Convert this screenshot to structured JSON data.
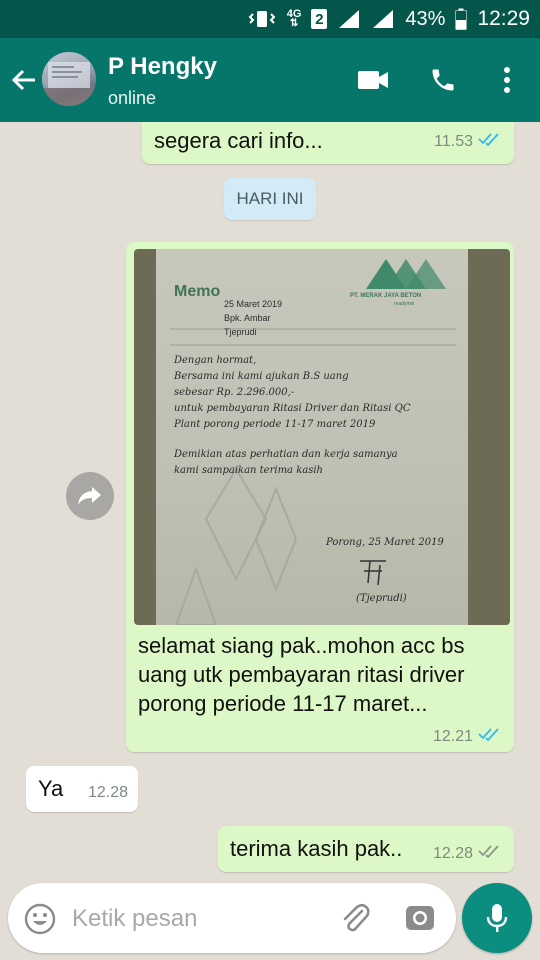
{
  "status_bar": {
    "network": "4G",
    "sim_slot": "2",
    "battery_percent": "43%",
    "time": "12:29"
  },
  "header": {
    "contact_name": "P Hengky",
    "contact_status": "online",
    "icons": [
      "back-arrow-icon",
      "avatar",
      "video-call-icon",
      "phone-icon",
      "more-vert-icon"
    ]
  },
  "colors": {
    "header": "#06766a",
    "status_bar": "#04564a",
    "outgoing_bubble": "#dcf8c6",
    "incoming_bubble": "#ffffff",
    "read_tick": "#34b7f1",
    "accent": "#0b8d80"
  },
  "messages": [
    {
      "direction": "out",
      "text": "segera cari info...",
      "time": "11.53",
      "status": "read"
    },
    {
      "type": "date_divider",
      "text": "HARI INI"
    },
    {
      "direction": "out",
      "type": "image",
      "forwardable": true,
      "image_text": {
        "memo_title": "Memo",
        "company": "PT. MERAK JAYA BETON",
        "company_sub": "readymix",
        "field_date": "25 Maret 2019",
        "field_to": "Bpk. Ambar",
        "field_from": "Tjeprudi",
        "body_lines": [
          "Dengan hormat,",
          "Bersama ini kami ajukan B.S uang",
          "sebesar Rp. 2.296.000,-",
          "untuk pembayaran Ritasi Driver dan Ritasi QC",
          "Plant porong periode 11-17 maret 2019",
          "Demikian atas perhatian dan kerja samanya",
          "kami sampaikan terima kasih"
        ],
        "signature_place": "Porong, 25 Maret 2019",
        "signature_name": "(Tjeprudi)"
      },
      "caption_lines": [
        "selamat siang pak..mohon acc bs",
        "uang utk pembayaran ritasi driver",
        "porong periode 11-17 maret..."
      ],
      "time": "12.21",
      "status": "read"
    },
    {
      "direction": "in",
      "text": "Ya",
      "time": "12.28"
    },
    {
      "direction": "out",
      "text": "terima kasih pak..",
      "time": "12.28",
      "status": "delivered"
    }
  ],
  "composer": {
    "placeholder": "Ketik pesan",
    "icons": [
      "emoji-icon",
      "attach-icon",
      "camera-icon",
      "mic-icon"
    ]
  }
}
